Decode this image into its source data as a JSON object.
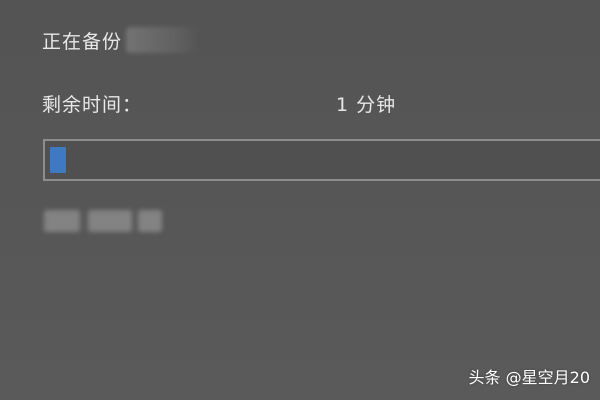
{
  "dialog": {
    "title": "正在备份",
    "remaining_label": "剩余时间：",
    "remaining_value": "1 分钟",
    "progress_fraction": 0.03
  },
  "watermark": {
    "text": "头条 @星空月20"
  },
  "colors": {
    "background": "#555555",
    "progress_fill": "#3f79c3",
    "progress_border": "#8d8d8d",
    "text": "#e8e8e8"
  }
}
